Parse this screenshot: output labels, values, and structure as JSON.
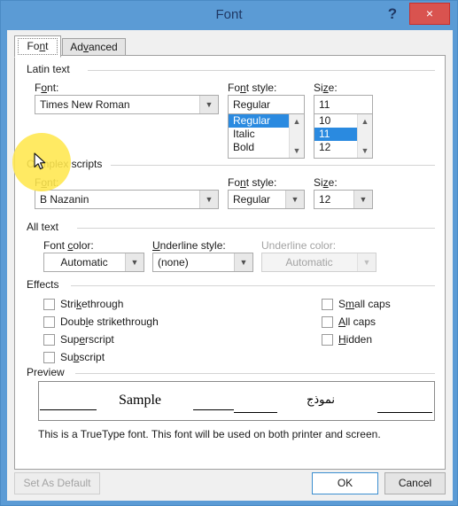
{
  "window": {
    "title": "Font",
    "help_label": "?",
    "close_label": "×"
  },
  "tabs": [
    {
      "label": "Font",
      "active": true
    },
    {
      "label": "Advanced",
      "active": false
    }
  ],
  "latin_text": {
    "group_title": "Latin text",
    "font_label": "Font:",
    "font_value": "Times New Roman",
    "style_label": "Font style:",
    "style_value": "Regular",
    "style_options": [
      "Regular",
      "Italic",
      "Bold"
    ],
    "style_selected": "Regular",
    "size_label": "Size:",
    "size_value": "11",
    "size_options": [
      "10",
      "11",
      "12"
    ],
    "size_selected": "11"
  },
  "complex_scripts": {
    "group_title": "Complex scripts",
    "font_label": "Font:",
    "font_value": "B Nazanin",
    "style_label": "Font style:",
    "style_value": "Regular",
    "size_label": "Size:",
    "size_value": "12"
  },
  "all_text": {
    "group_title": "All text",
    "font_color_label": "Font color:",
    "font_color_value": "Automatic",
    "underline_style_label": "Underline style:",
    "underline_style_value": "(none)",
    "underline_color_label": "Underline color:",
    "underline_color_value": "Automatic",
    "underline_color_disabled": true
  },
  "effects": {
    "group_title": "Effects",
    "left_column": [
      {
        "label": "Strikethrough",
        "checked": false
      },
      {
        "label": "Double strikethrough",
        "checked": false
      },
      {
        "label": "Superscript",
        "checked": false
      },
      {
        "label": "Subscript",
        "checked": false
      }
    ],
    "right_column": [
      {
        "label": "Small caps",
        "checked": false
      },
      {
        "label": "All caps",
        "checked": false
      },
      {
        "label": "Hidden",
        "checked": false
      }
    ]
  },
  "preview": {
    "group_title": "Preview",
    "latin_sample": "Sample",
    "complex_sample": "نموذج",
    "note": "This is a TrueType font. This font will be used on both printer and screen."
  },
  "footer": {
    "set_as_default": "Set As Default",
    "set_as_default_disabled": true,
    "ok": "OK",
    "cancel": "Cancel"
  },
  "colors": {
    "titlebar": "#5b9bd5",
    "title_text": "#1f3864",
    "close_button": "#d9534f",
    "selection": "#2a8ae0",
    "default_button_border": "#3b8ed0",
    "cursor_highlight": "#ffe74d"
  }
}
